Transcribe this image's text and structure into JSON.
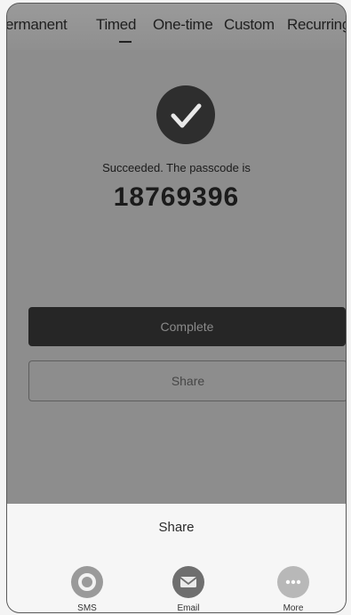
{
  "tabs": {
    "items": [
      "ermanent",
      "Timed",
      "One-time",
      "Custom",
      "Recurring"
    ],
    "active": "Timed"
  },
  "result": {
    "message": "Succeeded. The passcode is",
    "passcode": "18769396"
  },
  "buttons": {
    "complete_label": "Complete",
    "share_label": "Share"
  },
  "share_sheet": {
    "title": "Share",
    "options": [
      {
        "label": "SMS",
        "icon": "sms-icon",
        "color": "#9a9a9a"
      },
      {
        "label": "Email",
        "icon": "email-icon",
        "color": "#6f6f6f"
      },
      {
        "label": "More",
        "icon": "more-icon",
        "color": "#b8b8b8"
      }
    ]
  }
}
